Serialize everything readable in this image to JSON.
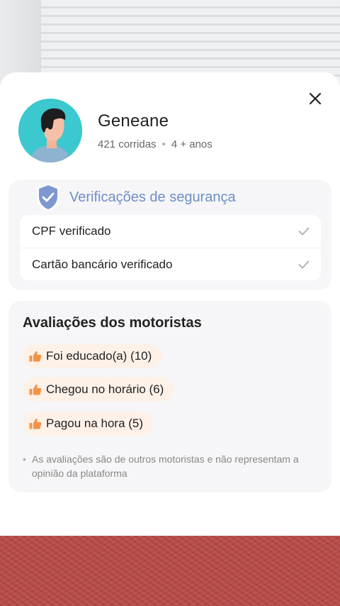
{
  "profile": {
    "name": "Geneane",
    "rides": "421 corridas",
    "separator": "•",
    "tenure": "4 + anos"
  },
  "security": {
    "title": "Verificações de segurança",
    "items": [
      {
        "label": "CPF verificado",
        "icon": "check-icon"
      },
      {
        "label": "Cartão bancário verificado",
        "icon": "check-icon"
      }
    ]
  },
  "reviews": {
    "title": "Avaliações dos motoristas",
    "chips": [
      {
        "label": "Foi educado(a) (10)",
        "icon": "thumbs-up-icon"
      },
      {
        "label": "Chegou no horário (6)",
        "icon": "thumbs-up-icon"
      },
      {
        "label": "Pagou na hora (5)",
        "icon": "thumbs-up-icon"
      }
    ],
    "note_bullet": "•",
    "note": "As avaliações são de outros motoristas e não representam a opinião da plataforma"
  },
  "colors": {
    "accent_blue": "#6f8ec6",
    "chip_bg": "#fdf1e8",
    "thumb_orange": "#f3934a",
    "avatar_bg": "#3cc8cf"
  }
}
